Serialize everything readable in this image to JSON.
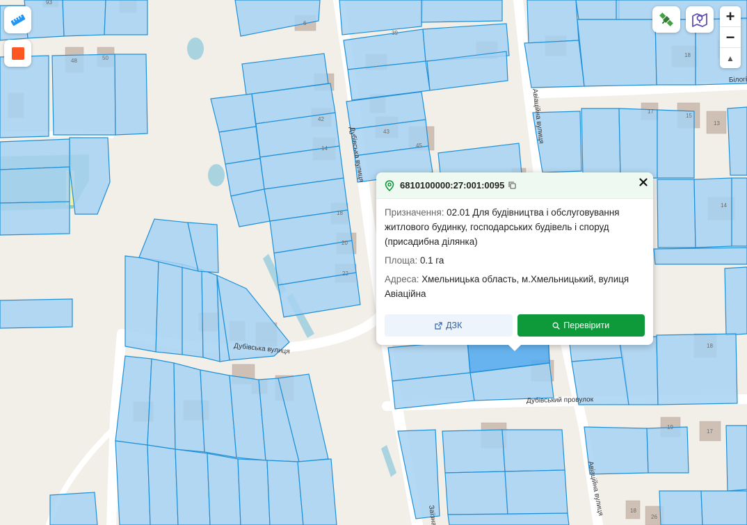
{
  "map": {
    "streets": {
      "dubivska_north": "Дубівська вулиця",
      "dubivska_west": "Дубівська вулиця",
      "aviatsiina_north": "Авіаційна вулиця",
      "aviatsiina_south": "Авіаційна вулиця",
      "dubivskyi_provulok": "Дубівський провулок",
      "bilohirska": "Білогі",
      "zaizna": "Заїзна"
    },
    "house_numbers": {
      "n93": "93",
      "n6": "6",
      "n48": "48",
      "n50": "50",
      "n39": "39",
      "n18a": "18",
      "n42": "42",
      "n14a": "14",
      "n43": "43",
      "n45": "45",
      "n17a": "17",
      "n15": "15",
      "n13": "13",
      "n18b": "18",
      "n20": "20",
      "n22": "22",
      "n14b": "14",
      "n18c": "18",
      "n19": "19",
      "n17b": "17",
      "n18d": "18",
      "n26": "26"
    }
  },
  "controls": {
    "ruler_icon": "ruler-icon",
    "record_icon": "stop-square-icon",
    "satellite_icon": "satellite-icon",
    "map_layers_icon": "map-pin-icon",
    "zoom_in": "+",
    "zoom_out": "−",
    "compass": "▲"
  },
  "popup": {
    "cadastral_number": "6810100000:27:001:0095",
    "purpose_label": "Призначення:",
    "purpose_value": "02.01 Для будівництва і обслуговування житлового будинку, господарських будівель і споруд (присадибна ділянка)",
    "area_label": "Площа:",
    "area_value": "0.1 га",
    "address_label": "Адреса:",
    "address_value": "Хмельницька область, м.Хмельницький, вулиця Авіаційна",
    "dzk_button": "ДЗК",
    "check_button": "Перевірити"
  },
  "colors": {
    "parcel_fill": "#a7d2f3",
    "parcel_stroke": "#1e90d8",
    "selected_fill": "#56acf0",
    "brand_green": "#0e9a3b",
    "background": "#f2efe9"
  }
}
